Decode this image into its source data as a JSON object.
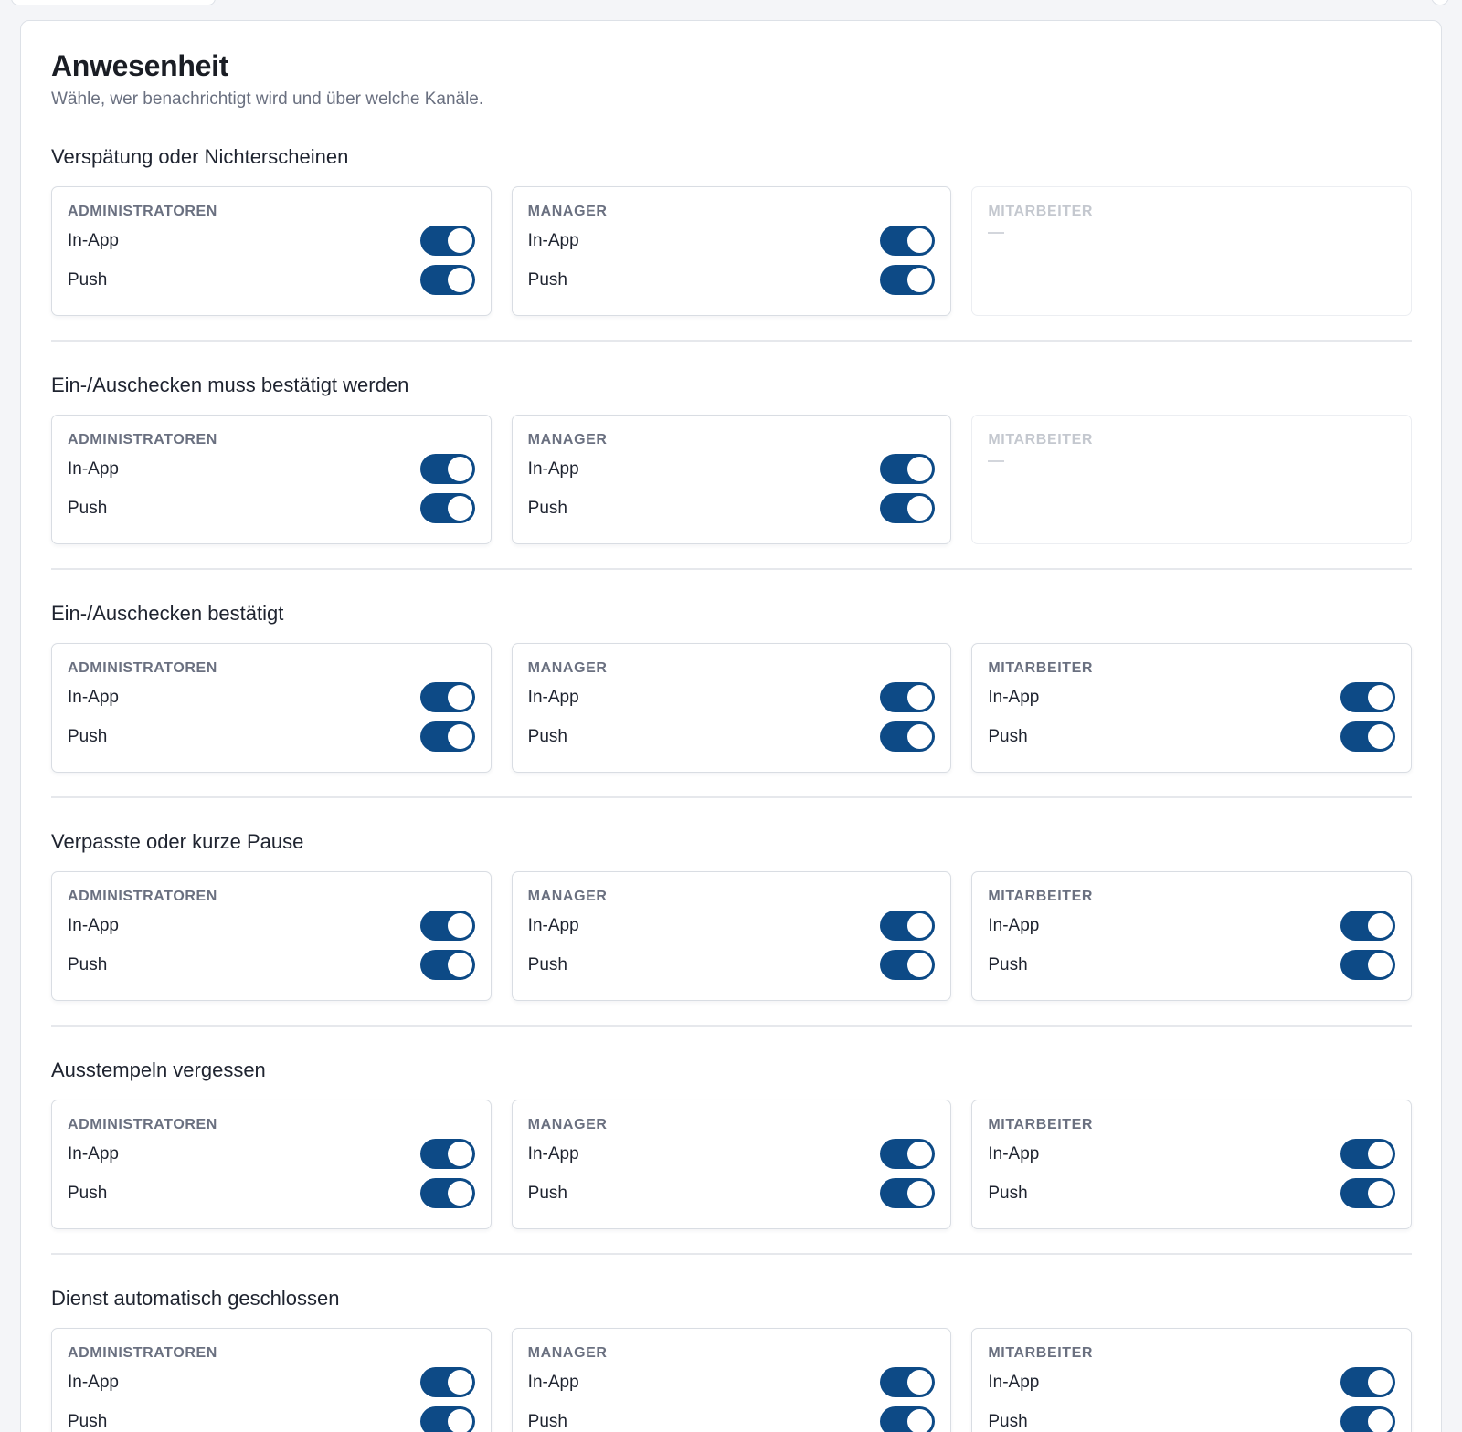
{
  "page": {
    "title": "Anwesenheit",
    "subtitle": "Wähle, wer benachrichtigt wird und über welche Kanäle."
  },
  "roles": {
    "admin": "ADMINISTRATOREN",
    "manager": "MANAGER",
    "employee": "MITARBEITER"
  },
  "channels": {
    "inapp": "In-App",
    "push": "Push"
  },
  "empty_marker": "—",
  "colors": {
    "toggle_on": "#0d4a86",
    "toggle_knob": "#ffffff"
  },
  "sections": [
    {
      "title": "Verspätung oder Nichterscheinen",
      "employee_enabled": false
    },
    {
      "title": "Ein-/Auschecken muss bestätigt werden",
      "employee_enabled": false
    },
    {
      "title": "Ein-/Auschecken bestätigt",
      "employee_enabled": true
    },
    {
      "title": "Verpasste oder kurze Pause",
      "employee_enabled": true
    },
    {
      "title": "Ausstempeln vergessen",
      "employee_enabled": true
    },
    {
      "title": "Dienst automatisch geschlossen",
      "employee_enabled": true
    }
  ]
}
